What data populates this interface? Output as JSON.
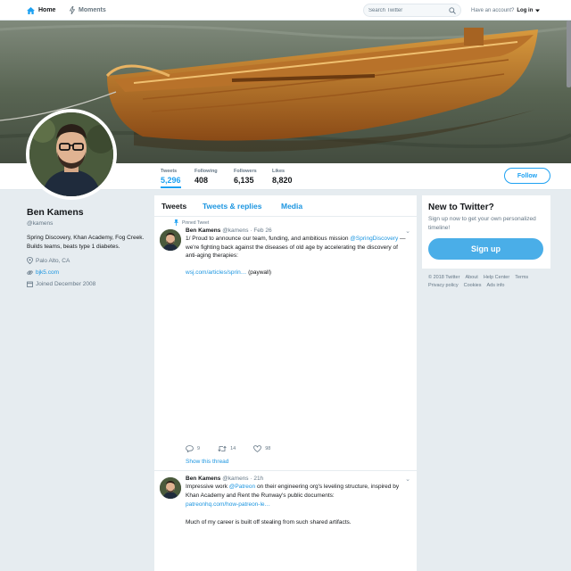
{
  "nav": {
    "home": "Home",
    "moments": "Moments",
    "search_placeholder": "Search Twitter",
    "have_account": "Have an account?",
    "login": "Log in"
  },
  "stats": [
    {
      "label": "Tweets",
      "value": "5,296"
    },
    {
      "label": "Following",
      "value": "408"
    },
    {
      "label": "Followers",
      "value": "6,135"
    },
    {
      "label": "Likes",
      "value": "8,820"
    }
  ],
  "follow_label": "Follow",
  "profile": {
    "name": "Ben Kamens",
    "handle": "@kamens",
    "bio": "Spring Discovery, Khan Academy, Fog Creek. Builds teams, beats type 1 diabetes.",
    "location": "Palo Alto, CA",
    "website": "bjk5.com",
    "joined": "Joined December 2008"
  },
  "tabs": [
    "Tweets",
    "Tweets & replies",
    "Media"
  ],
  "tweets": [
    {
      "pinned_label": "Pinned Tweet",
      "name": "Ben Kamens",
      "handle": "@kamens",
      "date": "· Feb 26",
      "text_1": "1/ Proud to announce our team, funding, and ambitious mission",
      "mention": "@SpringDiscovery",
      "text_2": " — we're fighting back against the diseases of old age by accelerating the discovery of anti-aging therapies:",
      "url": "wsj.com/articles/sprin…",
      "url_suffix": " (paywall)",
      "replies": "9",
      "retweets": "14",
      "likes": "98",
      "show_thread": "Show this thread"
    },
    {
      "name": "Ben Kamens",
      "handle": "@kamens",
      "date": "· 21h",
      "text_1": "Impressive work ",
      "mention": "@Patreon",
      "text_2": " on their engineering org's leveling structure, inspired by Khan Academy and Rent the Runway's public documents:",
      "url": "patreonhq.com/how-patreon-le…",
      "text_3": "Much of my career is built off stealing from such shared artifacts."
    }
  ],
  "new_to_twitter": {
    "title": "New to Twitter?",
    "subtitle": "Sign up now to get your own personalized timeline!",
    "signup": "Sign up"
  },
  "footer": [
    "© 2018 Twitter",
    "About",
    "Help Center",
    "Terms",
    "Privacy policy",
    "Cookies",
    "Ads info"
  ],
  "colors": {
    "accent": "#1da1f2",
    "link": "#1b95e0",
    "background": "#e6ecf0"
  }
}
